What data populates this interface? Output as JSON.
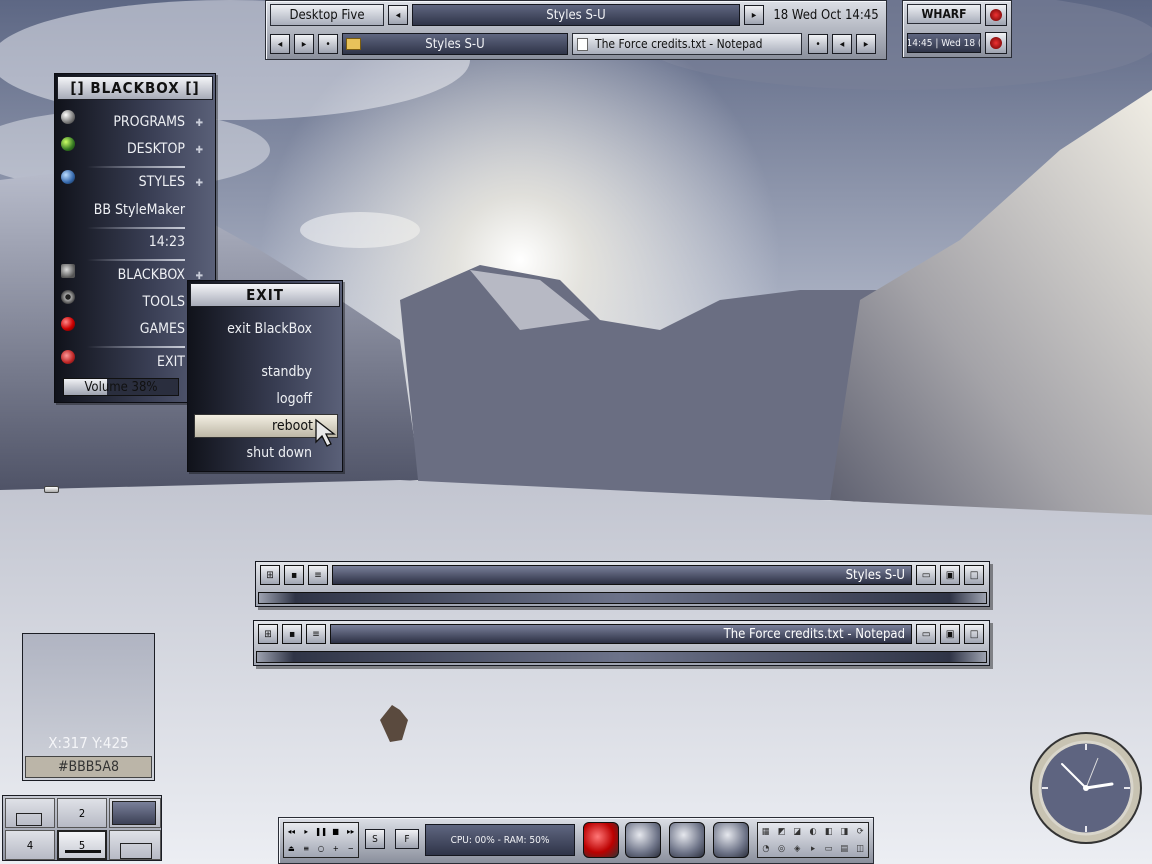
{
  "colors": {
    "menu_dark": "#2f3448",
    "accent_light": "#dcdfe6",
    "highlight": "#d8d2c0"
  },
  "toolbar": {
    "workspace": "Desktop Five",
    "window_title": "Styles S-U",
    "clock": "18 Wed Oct 14:45",
    "task_1": "Styles S-U",
    "task_2": "The Force credits.txt - Notepad"
  },
  "wharf": {
    "title": "WHARF",
    "clock": "14:45 | Wed 18 ("
  },
  "blackbox_menu": {
    "title": "[] BLACKBOX []",
    "items": [
      {
        "label": "PROGRAMS",
        "submenu": true
      },
      {
        "label": "DESKTOP",
        "submenu": true
      },
      {
        "label": "STYLES",
        "submenu": true
      },
      {
        "label": "BB StyleMaker",
        "submenu": false
      },
      {
        "label": "14:23",
        "submenu": false
      },
      {
        "label": "BLACKBOX",
        "submenu": true
      },
      {
        "label": "TOOLS",
        "submenu": false
      },
      {
        "label": "GAMES",
        "submenu": false
      },
      {
        "label": "EXIT",
        "submenu": false
      }
    ],
    "volume_label": "Volume 38%",
    "volume_level": 0.38
  },
  "exit_menu": {
    "title": "EXIT",
    "items": [
      "exit BlackBox",
      "standby",
      "logoff",
      "reboot",
      "shut down"
    ],
    "selected": "reboot"
  },
  "windows": [
    {
      "title": "Styles S-U"
    },
    {
      "title": "The Force credits.txt - Notepad"
    }
  ],
  "picker": {
    "coords": "X:317 Y:425",
    "color": "#BBB5A8"
  },
  "pager": {
    "desks": [
      "",
      "2",
      "",
      "4",
      "5",
      ""
    ]
  },
  "slit": {
    "monitor": "CPU: 00% - RAM: 50%",
    "btn_s": "S",
    "btn_f": "F"
  }
}
